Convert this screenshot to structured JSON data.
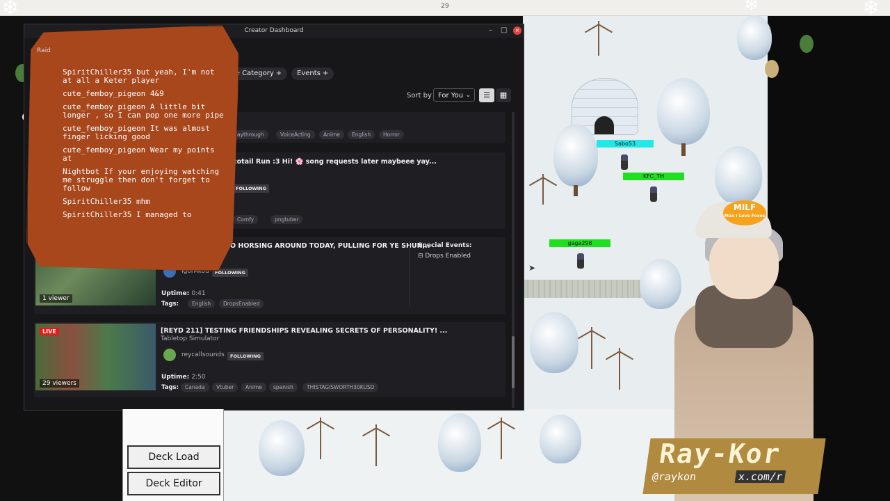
{
  "os": {
    "clock": "29"
  },
  "window": {
    "title": "Creator Dashboard",
    "minimize": "–",
    "maximize": "□",
    "close": "×"
  },
  "filters": {
    "game_category": "me Category +",
    "events": "Events +"
  },
  "sort": {
    "label": "Sort by",
    "value": "For You"
  },
  "cards": [
    {
      "tags": [
        "aythrough",
        "VoiceActing",
        "Anime",
        "English",
        "Horror"
      ]
    },
    {
      "title": "cotail Run :3 Hi! 🌸 song requests later maybeee yay...",
      "following": "FOLLOWING",
      "tags": [
        "Comfy",
        "pngtuber"
      ]
    },
    {
      "title": "O HORSING AROUND TODAY, PULLING FOR YE SHUN...",
      "channel": "IgorAkou",
      "following": "FOLLOWING",
      "viewers": "1 viewer",
      "uptime_label": "Uptime:",
      "uptime": "0:41",
      "tags_label": "Tags:",
      "tags": [
        "English",
        "DropsEnabled"
      ],
      "special_events_label": "Special Events:",
      "special_event": "Drops Enabled"
    },
    {
      "title": "[REYD 211] TESTING FRIENDSHIPS REVEALING SECRETS OF PERSONALITY! ...",
      "game": "Tabletop Simulator",
      "channel": "reycallsounds",
      "following": "FOLLOWING",
      "live": "LIVE",
      "viewers": "29 viewers",
      "uptime_label": "Uptime:",
      "uptime": "2:50",
      "tags_label": "Tags:",
      "tags": [
        "Canada",
        "Vtuber",
        "Anime",
        "spanish",
        "THISTAGISWORTH30KUSD"
      ]
    }
  ],
  "chat": {
    "raid_label": "Raid",
    "messages": [
      {
        "user": "SpiritChiller35",
        "text": "but yeah, I'm not at all a Keter player"
      },
      {
        "user": "cute_femboy_pigeon",
        "text": "4&9"
      },
      {
        "user": "cute_femboy_pigeon",
        "text": "A little bit longer , so I can pop one more pipe"
      },
      {
        "user": "cute_femboy_pigeon",
        "text": "It was almost finger licking good"
      },
      {
        "user": "cute_femboy_pigeon",
        "text": "Wear my points at"
      },
      {
        "user": "Nightbot",
        "text": "If your enjoying watching me struggle then don't forget to follow"
      },
      {
        "user": "SpiritChiller35",
        "text": "mhm"
      },
      {
        "user": "SpiritChiller35",
        "text": "I managed to"
      }
    ]
  },
  "game": {
    "players": [
      "Sabo53",
      "KFC_TH",
      "gaga298"
    ],
    "nametag_colors": [
      "#22e8e8",
      "#1ee01e",
      "#1ee01e"
    ]
  },
  "deck": {
    "load": "Deck Load",
    "editor": "Deck Editor"
  },
  "streamer": {
    "name": "Ray-Kor",
    "handle": "@raykon",
    "social": "x.com/r",
    "cap_text": "MILF",
    "cap_subtext": "Man I Love Foxes"
  }
}
